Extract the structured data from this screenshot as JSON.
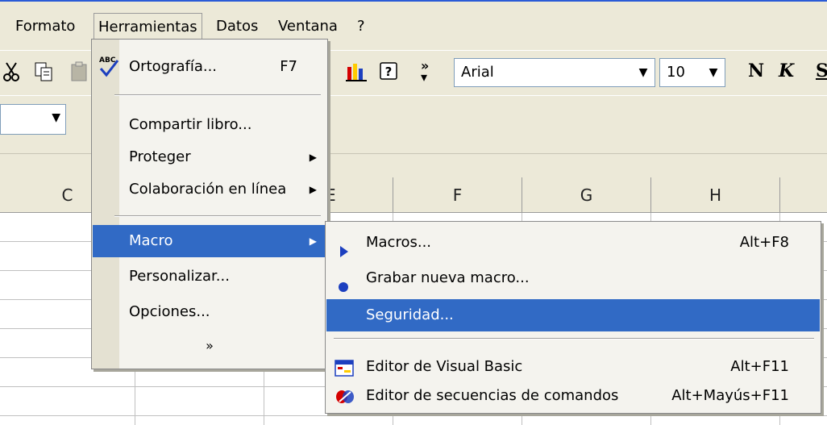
{
  "menubar": {
    "items": [
      "Formato",
      "Herramientas",
      "Datos",
      "Ventana",
      "?"
    ]
  },
  "toolbar": {
    "font_name": "Arial",
    "font_size": "10",
    "bold_label": "N",
    "italic_label": "K",
    "underline_label": "S"
  },
  "columns": [
    "C",
    "E",
    "F",
    "G",
    "H"
  ],
  "menu": {
    "items": [
      {
        "label": "Ortografía...",
        "shortcut": "F7"
      },
      {
        "label": "Compartir libro..."
      },
      {
        "label": "Proteger"
      },
      {
        "label": "Colaboración en línea"
      },
      {
        "label": "Macro"
      },
      {
        "label": "Personalizar..."
      },
      {
        "label": "Opciones..."
      }
    ],
    "expand": "»"
  },
  "submenu": {
    "items": [
      {
        "label": "Macros...",
        "shortcut": "Alt+F8"
      },
      {
        "label": "Grabar nueva macro..."
      },
      {
        "label": "Seguridad..."
      },
      {
        "label": "Editor de Visual Basic",
        "shortcut": "Alt+F11"
      },
      {
        "label": "Editor de secuencias de comandos",
        "shortcut": "Alt+Mayús+F11"
      }
    ]
  },
  "colors": {
    "highlight": "#316ac5",
    "menu_bg": "#f4f3ee",
    "chrome": "#ece9d8"
  }
}
